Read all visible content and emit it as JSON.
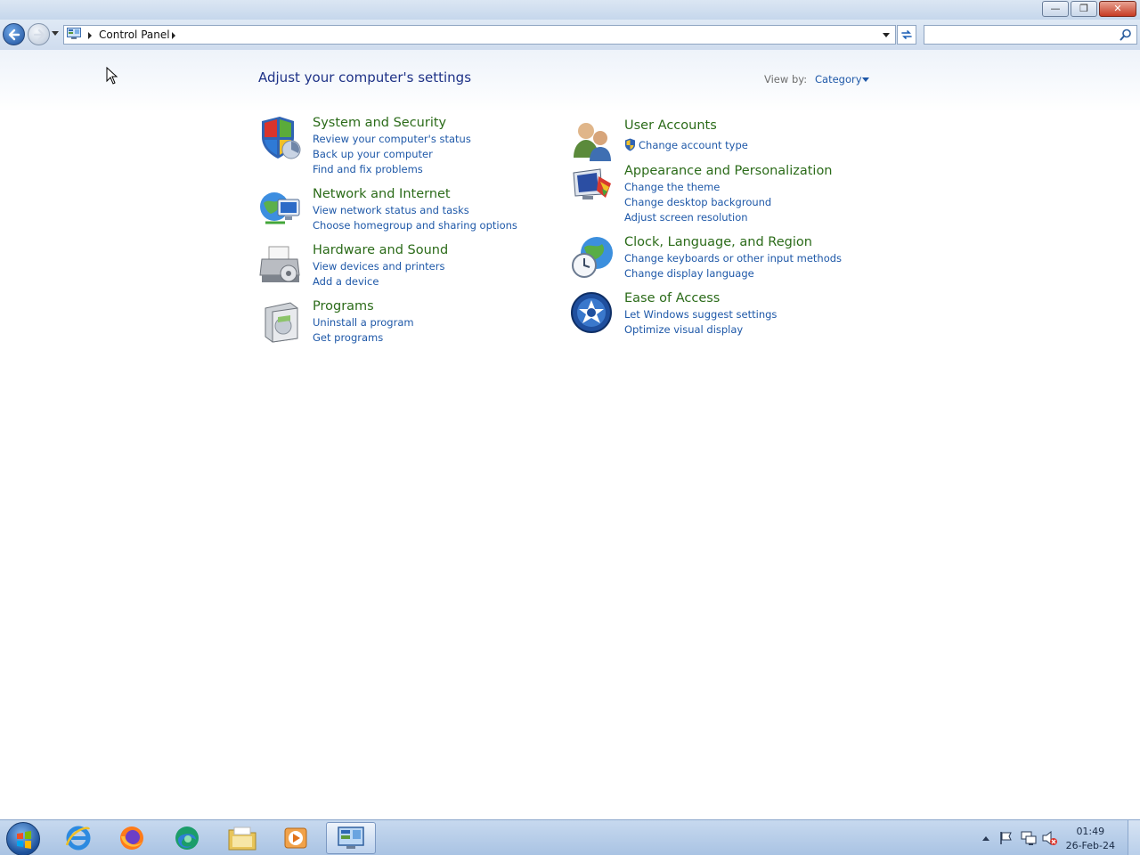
{
  "window": {
    "minimize_glyph": "—",
    "restore_glyph": "❐",
    "close_glyph": "✕"
  },
  "address": {
    "crumb": "Control Panel",
    "search_placeholder": ""
  },
  "main": {
    "heading": "Adjust your computer's settings",
    "view_by_label": "View by:",
    "view_by_value": "Category"
  },
  "categories_left": [
    {
      "title": "System and Security",
      "icon": "shield-icon",
      "links": [
        "Review your computer's status",
        "Back up your computer",
        "Find and fix problems"
      ]
    },
    {
      "title": "Network and Internet",
      "icon": "network-globe-icon",
      "links": [
        "View network status and tasks",
        "Choose homegroup and sharing options"
      ]
    },
    {
      "title": "Hardware and Sound",
      "icon": "printer-icon",
      "links": [
        "View devices and printers",
        "Add a device"
      ]
    },
    {
      "title": "Programs",
      "icon": "programs-box-icon",
      "links": [
        "Uninstall a program",
        "Get programs"
      ]
    }
  ],
  "categories_right": [
    {
      "title": "User Accounts",
      "icon": "users-icon",
      "links": [
        "Change account type"
      ]
    },
    {
      "title": "Appearance and Personalization",
      "icon": "monitor-paint-icon",
      "links": [
        "Change the theme",
        "Change desktop background",
        "Adjust screen resolution"
      ]
    },
    {
      "title": "Clock, Language, and Region",
      "icon": "clock-globe-icon",
      "links": [
        "Change keyboards or other input methods",
        "Change display language"
      ]
    },
    {
      "title": "Ease of Access",
      "icon": "ease-of-access-icon",
      "links": [
        "Let Windows suggest settings",
        "Optimize visual display"
      ]
    }
  ],
  "taskbar": {
    "pinned": [
      "internet-explorer-icon",
      "firefox-icon",
      "edge-icon",
      "file-explorer-icon",
      "media-player-icon",
      "control-panel-icon"
    ],
    "clock_time": "01:49",
    "clock_date": "26-Feb-24"
  },
  "colors": {
    "category_title": "#2b6b19",
    "link": "#1e58a8",
    "heading": "#1e3287"
  }
}
